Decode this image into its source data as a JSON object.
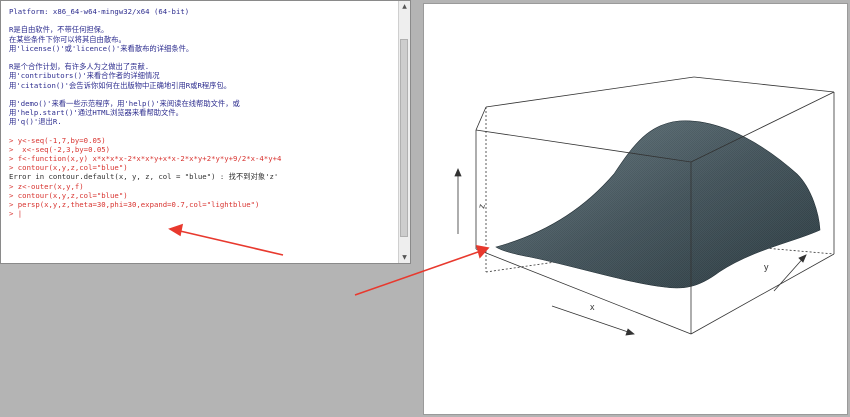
{
  "console": {
    "lines": [
      {
        "text": "Platform: x86_64-w64-mingw32/x64 (64-bit)",
        "style": "navy"
      },
      {
        "text": "",
        "style": "blank"
      },
      {
        "text": "R是自由软件，不带任何担保。",
        "style": "navy"
      },
      {
        "text": "在某些条件下你可以将其自由散布。",
        "style": "navy"
      },
      {
        "text": "用'license()'或'licence()'来看散布的详细条件。",
        "style": "navy"
      },
      {
        "text": "",
        "style": "blank"
      },
      {
        "text": "R是个合作计划，有许多人为之做出了贡献.",
        "style": "navy"
      },
      {
        "text": "用'contributors()'来看合作者的详细情况",
        "style": "navy"
      },
      {
        "text": "用'citation()'会告诉你如何在出版物中正确地引用R或R程序包。",
        "style": "navy"
      },
      {
        "text": "",
        "style": "blank"
      },
      {
        "text": "用'demo()'来看一些示范程序，用'help()'来阅读在线帮助文件，或",
        "style": "navy"
      },
      {
        "text": "用'help.start()'通过HTML浏览器来看帮助文件。",
        "style": "navy"
      },
      {
        "text": "用'q()'退出R.",
        "style": "navy"
      },
      {
        "text": "",
        "style": "blank"
      },
      {
        "text": "> y<-seq(-1,7,by=0.05)",
        "style": "red"
      },
      {
        "text": ">  x<-seq(-2,3,by=0.05)",
        "style": "red"
      },
      {
        "text": "> f<-function(x,y) x*x*x*x-2*x*x*y+x*x-2*x*y+2*y*y+9/2*x-4*y+4",
        "style": "red"
      },
      {
        "text": "> contour(x,y,z,col=\"blue\")",
        "style": "red"
      },
      {
        "text": "Error in contour.default(x, y, z, col = \"blue\") : 找不到对象'z'",
        "style": "dark"
      },
      {
        "text": "> z<-outer(x,y,f)",
        "style": "red"
      },
      {
        "text": "> contour(x,y,z,col=\"blue\")",
        "style": "red"
      },
      {
        "text": "> persp(x,y,z,theta=30,phi=30,expand=0.7,col=\"lightblue\")",
        "style": "red"
      },
      {
        "text": "> |",
        "style": "red"
      }
    ]
  },
  "plot": {
    "axis_labels": {
      "x": "x",
      "y": "y",
      "z": "z"
    },
    "surface_color": "#4f5f66",
    "mesh_color": "#1e2a30"
  },
  "annotation": {
    "arrow_color": "#e8392e"
  }
}
